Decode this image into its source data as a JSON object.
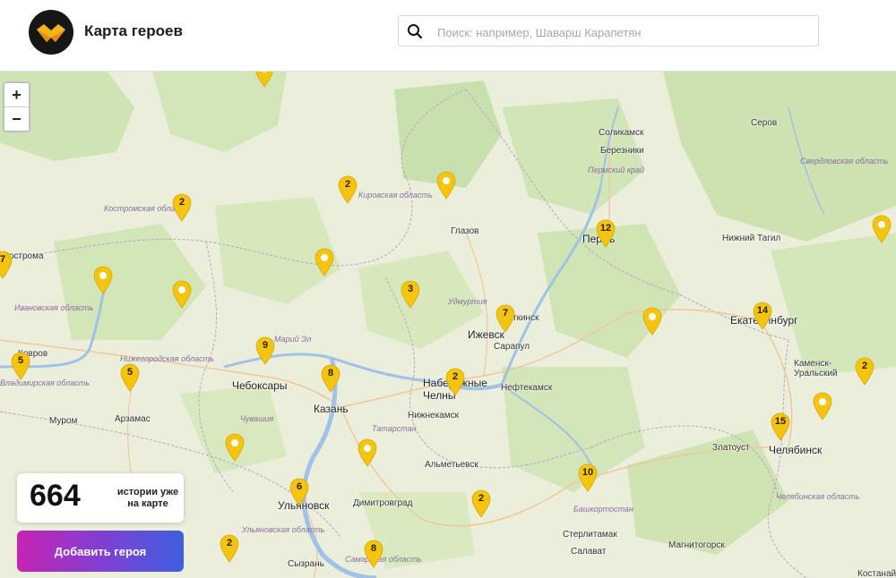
{
  "header": {
    "title": "Карта героев",
    "search_placeholder": "Поиск: например, Шаварш Карапетян"
  },
  "map_controls": {
    "zoom_in": "+",
    "zoom_out": "−"
  },
  "counter": {
    "value": "664",
    "label": "истории уже на карте"
  },
  "add_button": "Добавить героя",
  "colors": {
    "marker": "#f4c40f",
    "button_gradient_start": "#c623b3",
    "button_gradient_end": "#3f5fe0",
    "region_label": "#8a6fa0"
  },
  "cities": [
    "Соликамск",
    "Березники",
    "Серов",
    "Пермь",
    "Нижний Тагил",
    "Глазов",
    "Ижевск",
    "Воткинск",
    "Сарапул",
    "Екатеринбург",
    "Каменск-Уральский",
    "Чебоксары",
    "Казань",
    "Набережные Челны",
    "Нефтекамск",
    "Нижнекамск",
    "Муром",
    "Арзамас",
    "Альметьевск",
    "Златоуст",
    "Челябинск",
    "Ульяновск",
    "Димитровград",
    "Стерлитамак",
    "Салават",
    "Магнитогорск",
    "Сызрань",
    "Костанай",
    "Кострома",
    "Ковров"
  ],
  "regions": [
    "Костромская область",
    "Кировская область",
    "Пермский край",
    "Свердловская область",
    "Ивановская область",
    "Удмуртия",
    "Марий Эл",
    "Нижегородская область",
    "Владимирская область",
    "Чувашия",
    "Татарстан",
    "Башкортостан",
    "Ульяновская область",
    "Самарская область",
    "Челябинская область"
  ],
  "markers": [
    "2",
    "2",
    "",
    "2",
    "",
    "",
    "",
    "3",
    "7",
    "12",
    "14",
    "",
    "",
    "9",
    "8",
    "2",
    "2",
    "15",
    "",
    "5",
    "5",
    "",
    "6",
    "2",
    "10",
    "2",
    "8",
    "7",
    "",
    ""
  ]
}
